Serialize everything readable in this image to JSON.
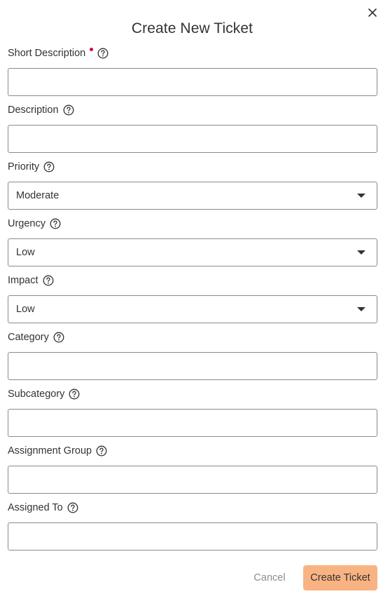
{
  "dialog": {
    "title": "Create New Ticket",
    "close_icon": "close-icon",
    "help_icon": "question-circle-icon",
    "accent_color": "#f9b383",
    "required_color": "#d6003d"
  },
  "fields": {
    "short_description": {
      "label": "Short Description",
      "value": "",
      "required": true
    },
    "description": {
      "label": "Description",
      "value": ""
    },
    "priority": {
      "label": "Priority",
      "value": "Moderate"
    },
    "urgency": {
      "label": "Urgency",
      "value": "Low"
    },
    "impact": {
      "label": "Impact",
      "value": "Low"
    },
    "category": {
      "label": "Category",
      "value": ""
    },
    "subcategory": {
      "label": "Subcategory",
      "value": ""
    },
    "assignment_group": {
      "label": "Assignment Group",
      "value": ""
    },
    "assigned_to": {
      "label": "Assigned To",
      "value": ""
    }
  },
  "footer": {
    "cancel_label": "Cancel",
    "create_label": "Create Ticket"
  }
}
